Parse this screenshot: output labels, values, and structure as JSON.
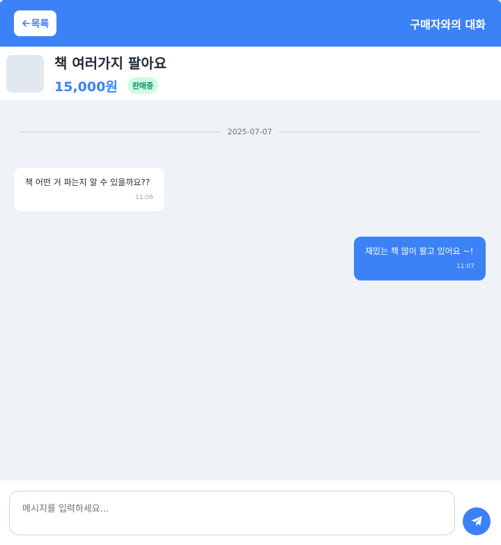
{
  "header": {
    "back_label": "목록",
    "title": "구매자와의 대화"
  },
  "product": {
    "title": "책 여러가지 팔아요",
    "price": "15,000원",
    "status": "판매중"
  },
  "chat": {
    "date": "2025-07-07",
    "messages": [
      {
        "direction": "incoming",
        "text": "책 어떤 거 파는지 알 수 있을까요??",
        "time": "11:06"
      },
      {
        "direction": "outgoing",
        "text": "재밌는 책 많이 팔고 있어요 ~!",
        "time": "11:07"
      }
    ]
  },
  "composer": {
    "placeholder": "메시지를 입력하세요...",
    "value": ""
  },
  "colors": {
    "accent": "#3b82f6",
    "chat_bg": "#eff2f7",
    "status_bg": "#d1fae5",
    "status_fg": "#059669"
  },
  "icons": {
    "back": "arrow-left-icon",
    "send": "paper-plane-icon"
  }
}
